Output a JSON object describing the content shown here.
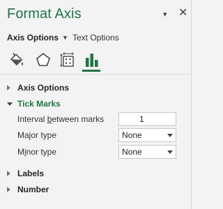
{
  "window": {
    "title": "Format Axis",
    "controls": {
      "dropdown": "▾",
      "close": "✕"
    }
  },
  "options": {
    "axis_options_label": "Axis Options",
    "text_options_label": "Text Options"
  },
  "icon_tabs": [
    {
      "name": "fill-line-icon"
    },
    {
      "name": "effects-icon"
    },
    {
      "name": "size-properties-icon"
    },
    {
      "name": "axis-options-icon",
      "selected": true
    }
  ],
  "sections": {
    "axis_options": "Axis Options",
    "tick_marks": "Tick Marks",
    "labels": "Labels",
    "number": "Number"
  },
  "tick_marks": {
    "interval_label_pre": "Interval ",
    "interval_label_ul": "b",
    "interval_label_post": "etween marks",
    "interval_value": "1",
    "major_label_pre": "Ma",
    "major_label_ul": "j",
    "major_label_post": "or type",
    "major_value": "None",
    "minor_label_pre": "M",
    "minor_label_ul": "i",
    "minor_label_post": "nor type",
    "minor_value": "None"
  },
  "colors": {
    "accent": "#217346",
    "background": "#f3f3f3"
  }
}
